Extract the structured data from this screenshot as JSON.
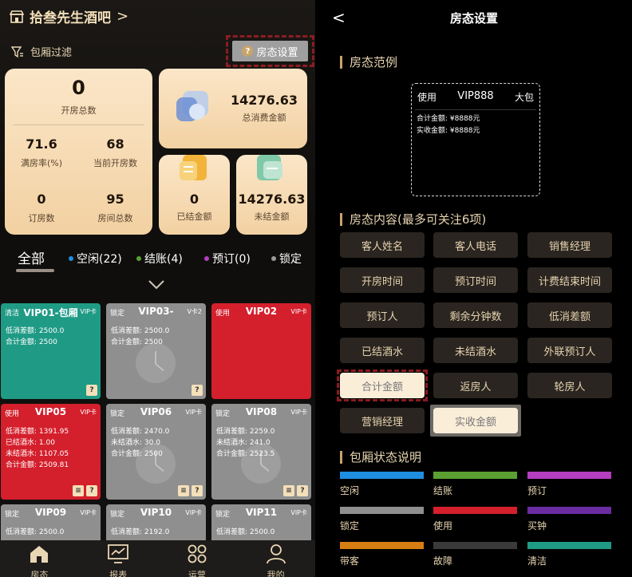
{
  "left": {
    "store_name": "拾叁先生酒吧",
    "store_chevron": ">",
    "filter_label": "包厢过滤",
    "room_setting_label": "房态设置",
    "stats": {
      "open_rooms": {
        "value": "0",
        "label": "开房总数"
      },
      "total_consumption": {
        "value": "14276.63",
        "label": "总消费金额"
      },
      "full_rate": {
        "value": "71.6",
        "label": "满房率(%)"
      },
      "current_open": {
        "value": "68",
        "label": "当前开房数"
      },
      "booked": {
        "value": "0",
        "label": "订房数"
      },
      "total_rooms": {
        "value": "95",
        "label": "房间总数"
      },
      "settled": {
        "value": "0",
        "label": "已结金额"
      },
      "unsettled": {
        "value": "14276.63",
        "label": "未结金额"
      }
    },
    "tabs": {
      "all": "全部",
      "items": [
        {
          "label": "空闲(22)",
          "color": "#1e8fe0"
        },
        {
          "label": "结账(4)",
          "color": "#5aa132"
        },
        {
          "label": "预订(0)",
          "color": "#b43fc0"
        },
        {
          "label": "锁定",
          "color": "#9a9a9a"
        }
      ]
    },
    "rooms": [
      {
        "status": "清洁",
        "name": "VIP01-包厢",
        "type": "VIP卡",
        "color": "#1f9a85",
        "lines": [
          "低消差额: 2500.0",
          "合计金额: 2500"
        ],
        "icons": [
          "?"
        ],
        "clock": false
      },
      {
        "status": "锁定",
        "name": "VIP03-",
        "type": "V卡2",
        "color": "#8f8f8f",
        "lines": [
          "低消差额: 2500.0",
          "合计金额: 2500"
        ],
        "icons": [
          "?"
        ],
        "clock": true
      },
      {
        "status": "使用",
        "name": "VIP02",
        "type": "VIP卡",
        "color": "#d41f2c",
        "lines": [],
        "icons": [],
        "clock": false
      },
      {
        "status": "使用",
        "name": "VIP05",
        "type": "VIP卡",
        "color": "#d41f2c",
        "lines": [
          "低消差额: 1391.95",
          "已结酒水: 1.00",
          "未结酒水: 1107.05",
          "合计金额: 2509.81"
        ],
        "icons": [
          "≡",
          "?"
        ],
        "clock": false
      },
      {
        "status": "锁定",
        "name": "VIP06",
        "type": "VIP卡",
        "color": "#8f8f8f",
        "lines": [
          "低消差额: 2470.0",
          "未结酒水: 30.0",
          "合计金额: 2500"
        ],
        "icons": [
          "≡",
          "?"
        ],
        "clock": true
      },
      {
        "status": "锁定",
        "name": "VIP08",
        "type": "VIP卡",
        "color": "#8f8f8f",
        "lines": [
          "低消差额: 2259.0",
          "未结酒水: 241.0",
          "合计金额: 2523.5"
        ],
        "icons": [
          "≡",
          "?"
        ],
        "clock": true
      },
      {
        "status": "锁定",
        "name": "VIP09",
        "type": "VIP卡",
        "color": "#8f8f8f",
        "lines": [
          "低消差额: 2500.0"
        ],
        "icons": [],
        "clock": false
      },
      {
        "status": "锁定",
        "name": "VIP10",
        "type": "VIP卡",
        "color": "#8f8f8f",
        "lines": [
          "低消差额: 2192.0"
        ],
        "icons": [],
        "clock": false
      },
      {
        "status": "锁定",
        "name": "VIP11",
        "type": "VIP卡",
        "color": "#8f8f8f",
        "lines": [
          "低消差额: 2500.0"
        ],
        "icons": [],
        "clock": false
      }
    ],
    "nav": [
      {
        "label": "房态",
        "icon": "home-icon"
      },
      {
        "label": "报表",
        "icon": "chart-icon"
      },
      {
        "label": "运营",
        "icon": "grid-icon"
      },
      {
        "label": "我的",
        "icon": "user-icon"
      }
    ]
  },
  "right": {
    "back": "<",
    "title": "房态设置",
    "sample_title": "房态范例",
    "sample": {
      "status": "使用",
      "name": "VIP888",
      "type": "大包",
      "lines": [
        "合计金额: ¥8888元",
        "实收金额: ¥8888元"
      ]
    },
    "content_title": "房态内容(最多可关注6项)",
    "chips": [
      {
        "label": "客人姓名",
        "selected": false
      },
      {
        "label": "客人电话",
        "selected": false
      },
      {
        "label": "销售经理",
        "selected": false
      },
      {
        "label": "开房时间",
        "selected": false
      },
      {
        "label": "预订时间",
        "selected": false
      },
      {
        "label": "计费结束时间",
        "selected": false
      },
      {
        "label": "预订人",
        "selected": false
      },
      {
        "label": "剩余分钟数",
        "selected": false
      },
      {
        "label": "低消差额",
        "selected": false
      },
      {
        "label": "已结酒水",
        "selected": false
      },
      {
        "label": "未结酒水",
        "selected": false
      },
      {
        "label": "外联预订人",
        "selected": false
      },
      {
        "label": "合计金额",
        "selected": true
      },
      {
        "label": "返房人",
        "selected": false
      },
      {
        "label": "轮房人",
        "selected": false
      },
      {
        "label": "营销经理",
        "selected": false
      },
      {
        "label": "实收金额",
        "selected": true
      }
    ],
    "legend_title": "包厢状态说明",
    "legend": [
      {
        "label": "空闲",
        "color": "#1e8fe0"
      },
      {
        "label": "结账",
        "color": "#5aa132"
      },
      {
        "label": "预订",
        "color": "#b43fc0"
      },
      {
        "label": "锁定",
        "color": "#8f8f8f"
      },
      {
        "label": "使用",
        "color": "#d41f2c"
      },
      {
        "label": "买钟",
        "color": "#6a2ca0"
      },
      {
        "label": "带客",
        "color": "#d77e12"
      },
      {
        "label": "故障",
        "color": "#3a3a3a"
      },
      {
        "label": "清洁",
        "color": "#1f9a85"
      }
    ]
  }
}
